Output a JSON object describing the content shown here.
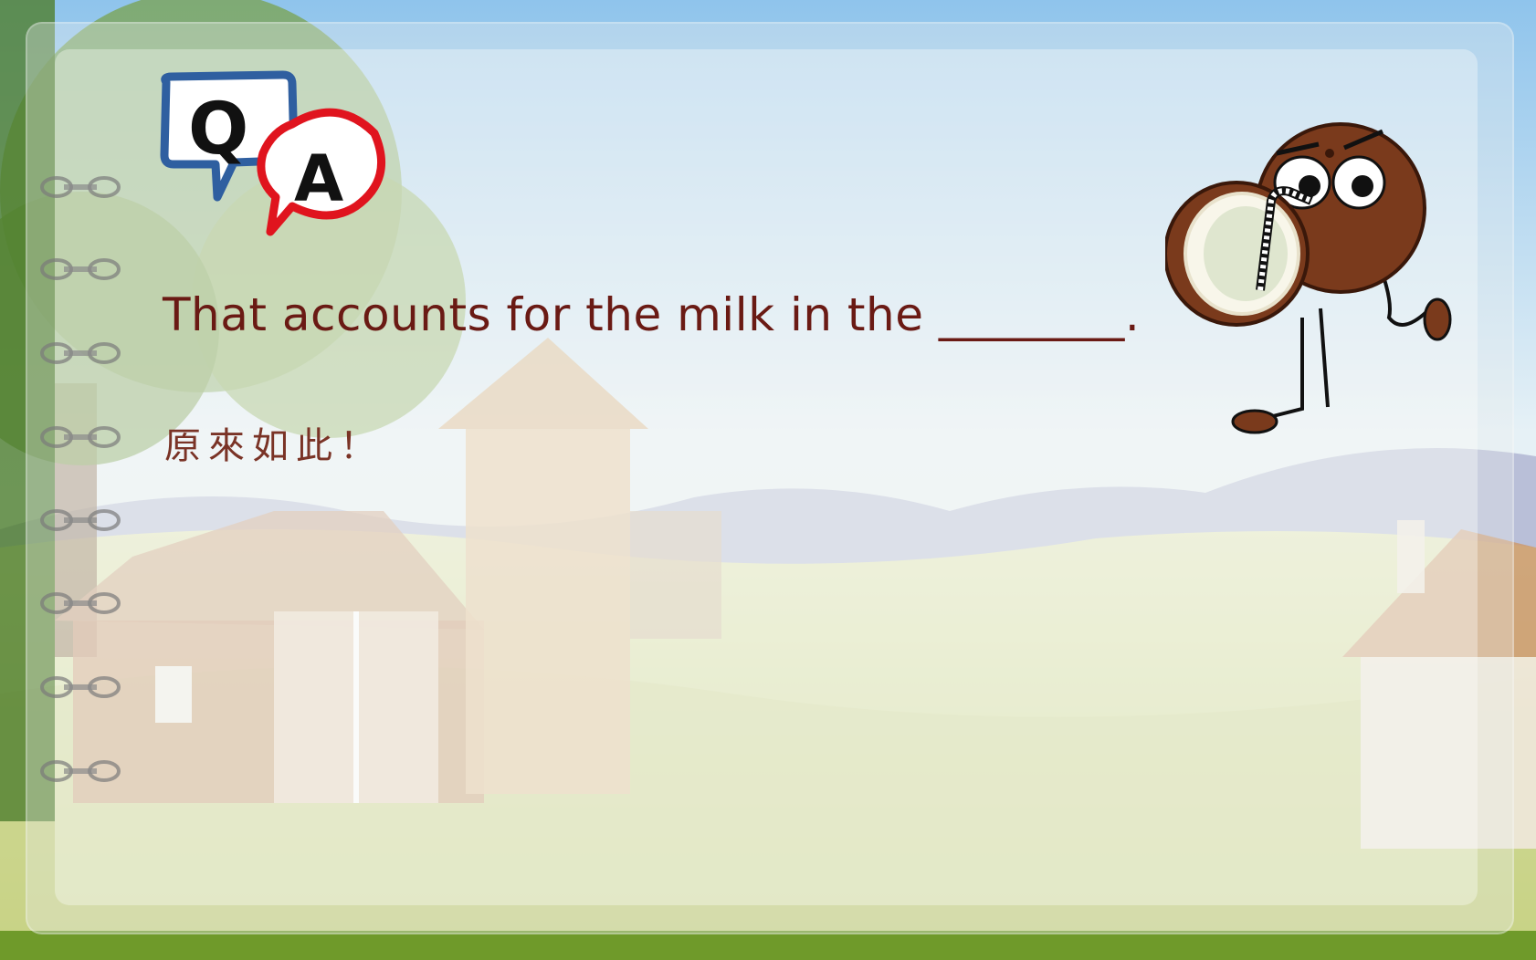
{
  "slide": {
    "question": "That accounts for the milk in the ________.",
    "answer": "原來如此！",
    "logo": {
      "q_letter": "Q",
      "a_letter": "A"
    }
  },
  "icons": {
    "qa_logo": "qa-speech-bubbles-icon",
    "mascot": "coconut-mascot-icon",
    "binder_rings": "binder-ring-icon"
  },
  "colors": {
    "sky_top": "#8fc4ec",
    "grass": "#cfd89a",
    "question_text": "#6a1a14",
    "answer_text": "#7a3326",
    "q_bubble": "#2f5fa0",
    "a_bubble": "#e0141e",
    "coconut_shell": "#7a3a1c"
  }
}
